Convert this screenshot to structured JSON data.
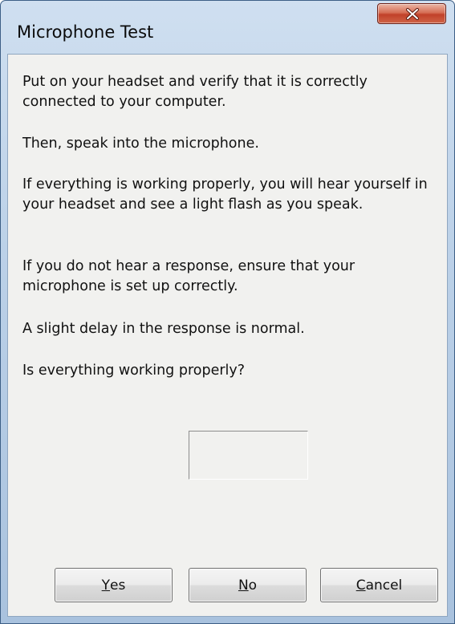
{
  "window": {
    "title": "Microphone Test",
    "close_icon": "close-icon"
  },
  "content": {
    "paragraphs": [
      "Put on your headset and verify that it is correctly connected to your computer.",
      "Then, speak into the microphone.",
      "If everything is working properly, you will hear yourself in your headset and see a light flash as you speak.",
      "If you do not hear a response, ensure that your microphone is set up correctly.",
      "A slight delay in the response is normal.",
      "Is everything working properly?"
    ]
  },
  "buttons": {
    "yes": {
      "accel": "Y",
      "rest": "es"
    },
    "no": {
      "accel": "N",
      "rest": "o"
    },
    "cancel": {
      "accel": "C",
      "rest": "ancel"
    }
  },
  "colors": {
    "close_button": "#c1412a",
    "frame": "#bcd1e8",
    "client_background": "#f1f1ef"
  }
}
